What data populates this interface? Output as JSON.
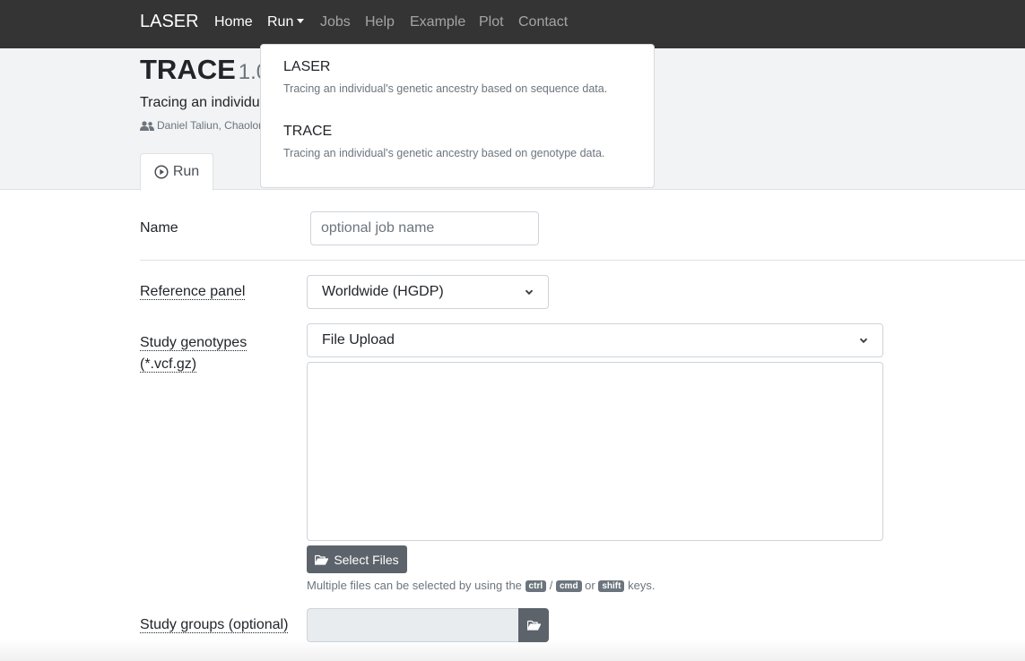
{
  "nav": {
    "brand": "LASER",
    "items": [
      {
        "label": "Home",
        "active": true
      },
      {
        "label": "Run",
        "active": true
      },
      {
        "label": "Jobs",
        "active": false
      },
      {
        "label": "Help",
        "active": false
      },
      {
        "label": "Example",
        "active": false
      },
      {
        "label": "Plot",
        "active": false
      },
      {
        "label": "Contact",
        "active": false
      }
    ]
  },
  "dropdown": {
    "items": [
      {
        "title": "LASER",
        "description": "Tracing an individual's genetic ancestry based on sequence data."
      },
      {
        "title": "TRACE",
        "description": "Tracing an individual's genetic ancestry based on genotype data."
      }
    ]
  },
  "header": {
    "title": "TRACE",
    "version": "1.0",
    "subtitle": "Tracing an individual's genetic ancestry based on genotype data.",
    "authors": "Daniel Taliun, Chaolong Wang"
  },
  "tab": {
    "label": "Run",
    "icon": "play-circle-icon"
  },
  "form": {
    "name_label": "Name",
    "name_placeholder": "optional job name",
    "reference_label": "Reference panel",
    "reference_value": "Worldwide (HGDP)",
    "genotypes_label_line1": "Study genotypes",
    "genotypes_label_line2": "(*.vcf.gz)",
    "upload_value": "File Upload",
    "select_files_label": "Select Files",
    "hint_prefix": "Multiple files can be selected by using the",
    "hint_kbd1": "ctrl",
    "hint_sep": "/",
    "hint_kbd2": "cmd",
    "hint_or": "or",
    "hint_kbd3": "shift",
    "hint_suffix": "keys.",
    "groups_label": "Study groups (optional)"
  },
  "colors": {
    "navbar": "#343434",
    "header_band": "#f1f3f5",
    "button": "#5c636a"
  }
}
